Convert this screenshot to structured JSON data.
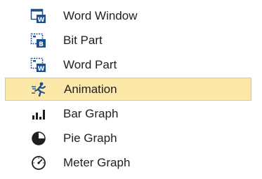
{
  "menu": {
    "items": [
      {
        "label": "Word Window",
        "icon": "word-window-icon",
        "selected": false
      },
      {
        "label": "Bit Part",
        "icon": "bit-part-icon",
        "selected": false
      },
      {
        "label": "Word Part",
        "icon": "word-part-icon",
        "selected": false
      },
      {
        "label": "Animation",
        "icon": "animation-icon",
        "selected": true
      },
      {
        "label": "Bar Graph",
        "icon": "bar-graph-icon",
        "selected": false
      },
      {
        "label": "Pie Graph",
        "icon": "pie-graph-icon",
        "selected": false
      },
      {
        "label": "Meter Graph",
        "icon": "meter-graph-icon",
        "selected": false
      }
    ],
    "colors": {
      "selection_fill": "#fce9a9",
      "selection_border": "#e6c96b",
      "icon_accent": "#1e4f8c",
      "text": "#1f1f1f"
    }
  }
}
